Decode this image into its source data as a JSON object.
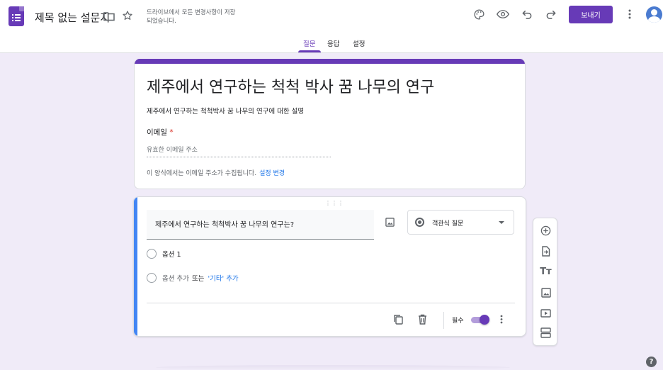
{
  "header": {
    "doc_title": "제목 없는 설문지",
    "save_status": "드라이브에서 모든 변경사항이 저장되었습니다.",
    "send_label": "보내기",
    "icons": [
      "folder-icon",
      "star-icon",
      "palette-icon",
      "preview-eye-icon",
      "undo-icon",
      "redo-icon",
      "more-vert-icon"
    ]
  },
  "tabs": [
    {
      "label": "질문",
      "active": true
    },
    {
      "label": "응답",
      "active": false
    },
    {
      "label": "설정",
      "active": false
    }
  ],
  "form": {
    "title": "제주에서 연구하는 척척 박사 꿈 나무의 연구",
    "description": "제주에서 연구하는 척척박사 꿈 나무의 연구에 대한 설명",
    "email_label": "이메일",
    "required_mark": "*",
    "email_placeholder": "유효한 이메일 주소",
    "collect_note": "이 양식에서는 이메일 주소가 수집됩니다.",
    "collect_link": "설정 변경"
  },
  "question": {
    "title": "제주에서 연구하는 척척박사 꿈 나무의 연구는?",
    "type_label": "객관식 질문",
    "options": [
      "옵션 1"
    ],
    "add_option": "옵션 추가",
    "or_text": "또는",
    "add_other": "'기타' 추가",
    "required_label": "필수",
    "required_on": true
  },
  "side_toolbar": [
    "add-question-icon",
    "import-questions-icon",
    "add-title-icon",
    "add-image-icon",
    "add-video-icon",
    "add-section-icon"
  ],
  "colors": {
    "accent": "#673ab7",
    "background": "#f0ebf8",
    "active_bar": "#4285f4",
    "link": "#1a73e8"
  }
}
